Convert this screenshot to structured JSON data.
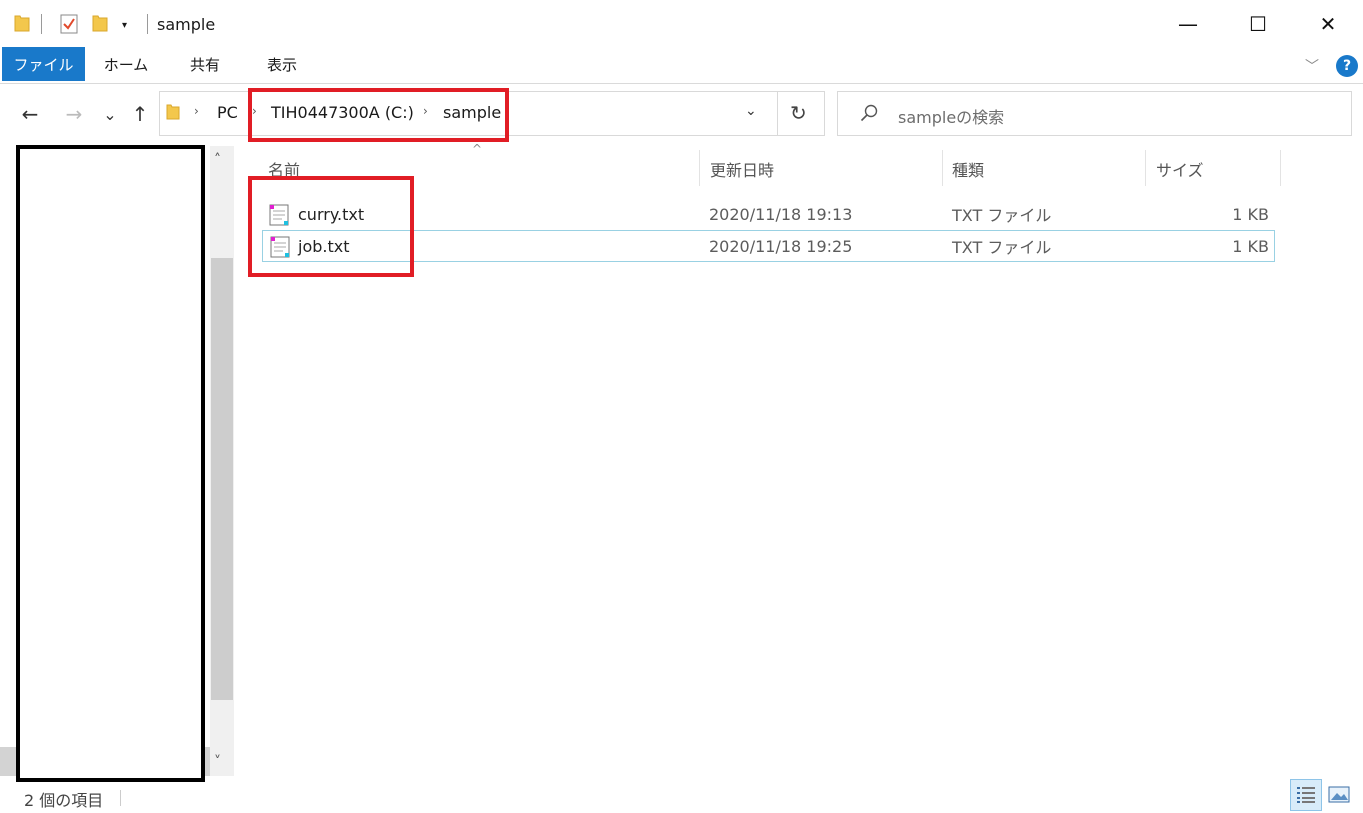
{
  "window": {
    "title": "sample",
    "minimize_glyph": "—",
    "maximize_glyph": "☐",
    "close_glyph": "✕"
  },
  "quick_access": {
    "dropdown_glyph": "▾",
    "icons": [
      "folder-icon",
      "properties-icon",
      "new-folder-icon"
    ]
  },
  "ribbon": {
    "tabs": [
      "ファイル",
      "ホーム",
      "共有",
      "表示"
    ],
    "expand_glyph": "﹀",
    "help_glyph": "?"
  },
  "navigation": {
    "back_glyph": "←",
    "forward_glyph": "→",
    "recent_glyph": "⌄",
    "up_glyph": "↑"
  },
  "address": {
    "crumbs": [
      "PC",
      "TIH0447300A (C:)",
      "sample"
    ],
    "separator": "›",
    "dropdown_glyph": "⌄",
    "refresh_glyph": "↻"
  },
  "search": {
    "placeholder": "sampleの検索"
  },
  "file_list": {
    "columns": [
      "名前",
      "更新日時",
      "種類",
      "サイズ"
    ],
    "sort_glyph": "^",
    "rows": [
      {
        "name": "curry.txt",
        "modified": "2020/11/18 19:13",
        "type": "TXT ファイル",
        "size": "1 KB",
        "selected": false
      },
      {
        "name": "job.txt",
        "modified": "2020/11/18 19:25",
        "type": "TXT ファイル",
        "size": "1 KB",
        "selected": true
      }
    ]
  },
  "scrollbar": {
    "up_glyph": "˄",
    "down_glyph": "˅"
  },
  "status": {
    "item_count": "2 個の項目"
  },
  "colors": {
    "accent": "#1979ca",
    "highlight_red": "#e11d25",
    "selection_border": "#99d1e3"
  }
}
